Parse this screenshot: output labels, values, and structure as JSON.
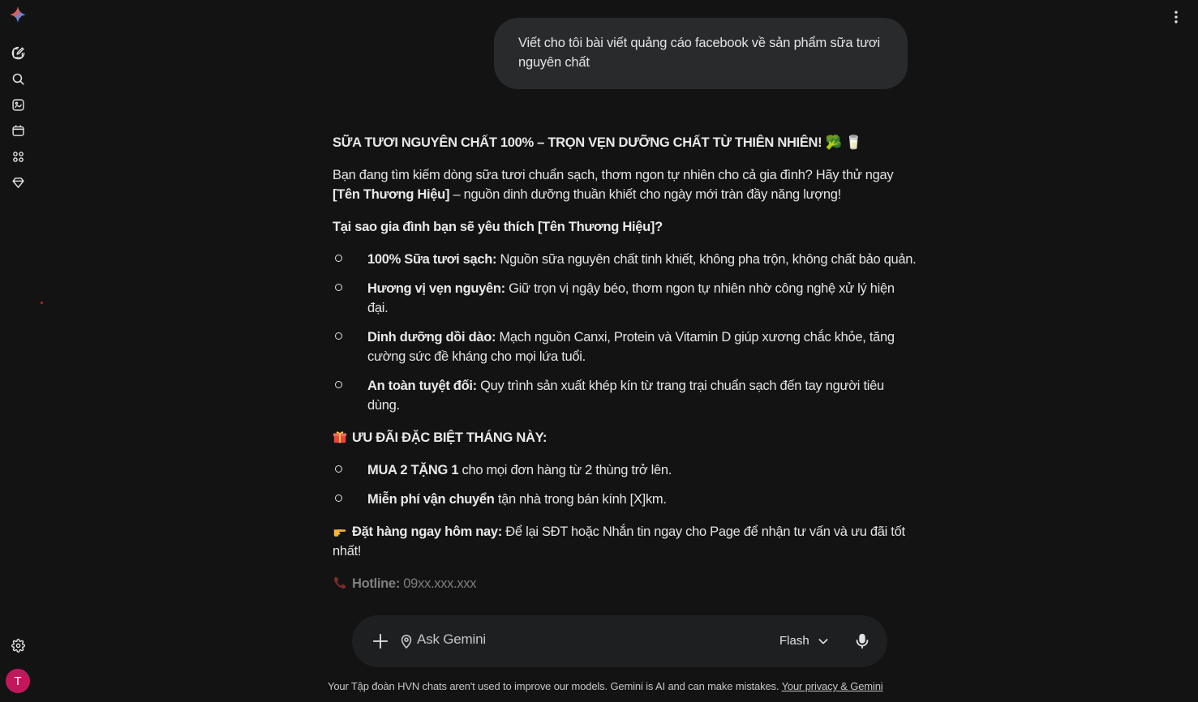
{
  "app": {
    "name": "Gemini",
    "avatar_letter": "T"
  },
  "sidebar": {
    "items": [
      {
        "icon": "new-chat-icon"
      },
      {
        "icon": "search-icon"
      },
      {
        "icon": "gallery-icon"
      },
      {
        "icon": "notebook-icon"
      },
      {
        "icon": "apps-icon"
      },
      {
        "icon": "gem-icon"
      }
    ],
    "settings_icon": "gear-icon"
  },
  "conversation": {
    "user_prompt": "Viết cho tôi bài viết quảng cáo facebook về sản phẩm sữa tươi nguyên chất",
    "response": {
      "headline": "SỮA TƯƠI NGUYÊN CHẤT 100% – TRỌN VẸN DƯỠNG CHẤT TỪ THIÊN NHIÊN! 🥦 🥛",
      "intro_plain": "Bạn đang tìm kiếm dòng sữa tươi chuẩn sạch, thơm ngon tự nhiên cho cả gia đình? Hãy thử ngay ",
      "intro_bold": "[Tên Thương Hiệu]",
      "intro_tail": " – nguồn dinh dưỡng thuần khiết cho ngày mới tràn đầy năng lượng!",
      "why_heading": "Tại sao gia đình bạn sẽ yêu thích [Tên Thương Hiệu]?",
      "benefits": [
        {
          "bold": "100% Sữa tươi sạch:",
          "text": " Nguồn sữa nguyên chất tinh khiết, không pha trộn, không chất bảo quản."
        },
        {
          "bold": "Hương vị vẹn nguyên:",
          "text": " Giữ trọn vị ngậy béo, thơm ngon tự nhiên nhờ công nghệ xử lý hiện đại."
        },
        {
          "bold": "Dinh dưỡng dồi dào:",
          "text": " Mạch nguồn Canxi, Protein và Vitamin D giúp xương chắc khỏe, tăng cường sức đề kháng cho mọi lứa tuổi."
        },
        {
          "bold": "An toàn tuyệt đối:",
          "text": " Quy trình sản xuất khép kín từ trang trại chuẩn sạch đến tay người tiêu dùng."
        }
      ],
      "offer_heading": "ƯU ĐÃI ĐẶC BIỆT THÁNG NÀY:",
      "offers": [
        {
          "bold": "MUA 2 TẶNG 1",
          "text": " cho mọi đơn hàng từ 2 thùng trở lên."
        },
        {
          "bold": "Miễn phí vận chuyển",
          "text": " tận nhà trong bán kính [X]km."
        }
      ],
      "cta_bold": "Đặt hàng ngay hôm nay:",
      "cta_text": " Để lại SĐT hoặc Nhắn tin ngay cho Page để nhận tư vấn và ưu đãi tốt nhất!",
      "hotline_label": "Hotline:",
      "hotline_value": " 09xx.xxx.xxx"
    }
  },
  "input": {
    "placeholder": "Ask Gemini",
    "model_label": "Flash"
  },
  "footer": {
    "text": "Your Tập đoàn HVN chats aren't used to improve our models. Gemini is AI and can make mistakes. ",
    "link": "Your privacy & Gemini"
  },
  "colors": {
    "background": "#131314",
    "bubble": "#282a2c",
    "input": "#1e1f20",
    "avatar": "#c2185b"
  }
}
